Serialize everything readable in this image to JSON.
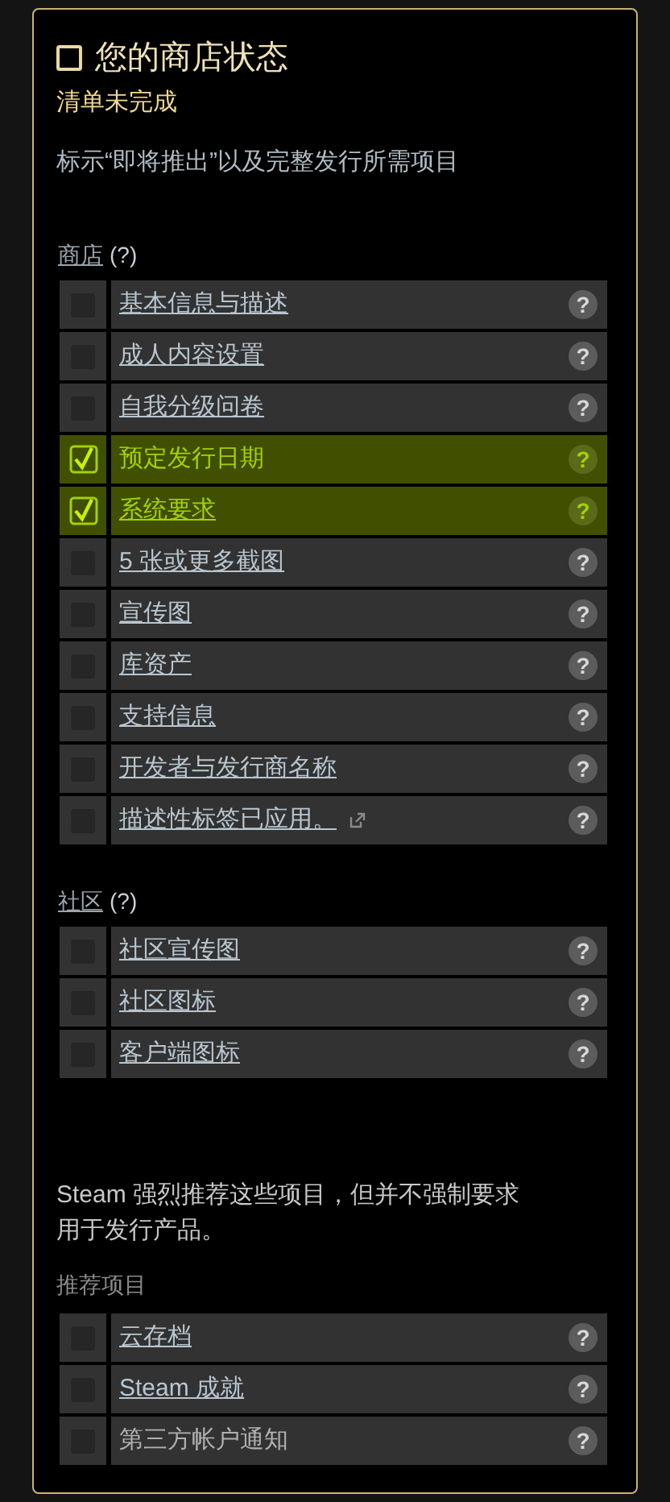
{
  "header": {
    "title": "您的商店状态",
    "checked": false,
    "status": "清单未完成",
    "description": "标示“即将推出”以及完整发行所需项目"
  },
  "sections": [
    {
      "title": "商店",
      "help": "(?)",
      "title_link": true,
      "items": [
        {
          "label": "基本信息与描述",
          "checked": false,
          "link": true,
          "external": false,
          "help": "?"
        },
        {
          "label": "成人内容设置",
          "checked": false,
          "link": true,
          "external": false,
          "help": "?"
        },
        {
          "label": "自我分级问卷",
          "checked": false,
          "link": true,
          "external": false,
          "help": "?"
        },
        {
          "label": "预定发行日期",
          "checked": true,
          "link": false,
          "external": false,
          "help": "?"
        },
        {
          "label": "系统要求",
          "checked": true,
          "link": true,
          "external": false,
          "help": "?"
        },
        {
          "label": "5 张或更多截图",
          "checked": false,
          "link": true,
          "external": false,
          "help": "?"
        },
        {
          "label": "宣传图",
          "checked": false,
          "link": true,
          "external": false,
          "help": "?"
        },
        {
          "label": "库资产",
          "checked": false,
          "link": true,
          "external": false,
          "help": "?"
        },
        {
          "label": "支持信息",
          "checked": false,
          "link": true,
          "external": false,
          "help": "?"
        },
        {
          "label": "开发者与发行商名称",
          "checked": false,
          "link": true,
          "external": false,
          "help": "?"
        },
        {
          "label": "描述性标签已应用。",
          "checked": false,
          "link": true,
          "external": true,
          "help": "?"
        }
      ]
    },
    {
      "title": "社区",
      "help": "(?)",
      "title_link": true,
      "items": [
        {
          "label": "社区宣传图",
          "checked": false,
          "link": true,
          "external": false,
          "help": "?"
        },
        {
          "label": "社区图标",
          "checked": false,
          "link": true,
          "external": false,
          "help": "?"
        },
        {
          "label": "客户端图标",
          "checked": false,
          "link": true,
          "external": false,
          "help": "?"
        }
      ]
    }
  ],
  "recommended": {
    "description": "Steam 强烈推荐这些项目，但并不强制要求用于发行产品。",
    "title": "推荐项目",
    "items": [
      {
        "label": "云存档",
        "checked": false,
        "link": true,
        "external": false,
        "help": "?"
      },
      {
        "label": "Steam 成就",
        "checked": false,
        "link": true,
        "external": false,
        "help": "?"
      },
      {
        "label": "第三方帐户通知",
        "checked": false,
        "link": false,
        "external": false,
        "help": "?"
      }
    ]
  }
}
